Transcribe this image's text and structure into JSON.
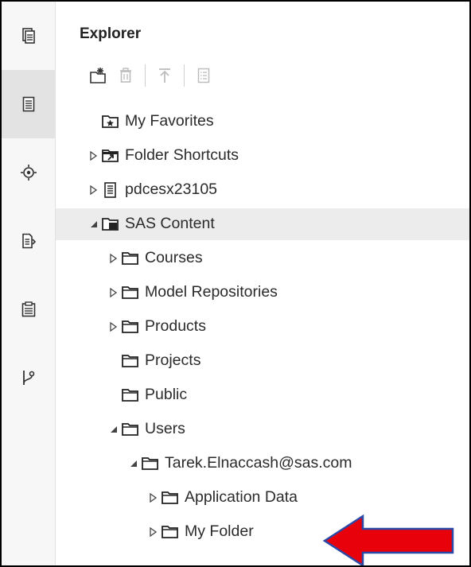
{
  "sidebar": {
    "buttons": [
      {
        "icon": "open-documents-icon"
      },
      {
        "icon": "explorer-icon"
      },
      {
        "icon": "libraries-icon"
      },
      {
        "icon": "snippets-icon"
      },
      {
        "icon": "tasks-icon"
      },
      {
        "icon": "git-repository-icon"
      }
    ],
    "active_index": 1
  },
  "explorer": {
    "title": "Explorer",
    "toolbar": [
      {
        "icon": "new-item-icon",
        "enabled": true
      },
      {
        "icon": "delete-icon",
        "enabled": false
      },
      {
        "icon": "upload-icon",
        "enabled": false
      },
      {
        "icon": "properties-icon",
        "enabled": false
      }
    ]
  },
  "tree": [
    {
      "label": "My Favorites",
      "level": 0,
      "twisty": "none",
      "icon": "favorites-folder-icon"
    },
    {
      "label": "Folder Shortcuts",
      "level": 0,
      "twisty": "collapsed",
      "icon": "folder-shortcut-icon"
    },
    {
      "label": "pdcesx23105",
      "level": 0,
      "twisty": "collapsed",
      "icon": "server-icon"
    },
    {
      "label": "SAS Content",
      "level": 0,
      "twisty": "expanded",
      "icon": "sas-content-icon",
      "selected": true
    },
    {
      "label": "Courses",
      "level": 1,
      "twisty": "collapsed",
      "icon": "folder-icon"
    },
    {
      "label": "Model Repositories",
      "level": 1,
      "twisty": "collapsed",
      "icon": "folder-icon"
    },
    {
      "label": "Products",
      "level": 1,
      "twisty": "collapsed",
      "icon": "folder-icon"
    },
    {
      "label": "Projects",
      "level": 1,
      "twisty": "none",
      "icon": "folder-icon"
    },
    {
      "label": "Public",
      "level": 1,
      "twisty": "none",
      "icon": "folder-icon"
    },
    {
      "label": "Users",
      "level": 1,
      "twisty": "expanded",
      "icon": "folder-icon"
    },
    {
      "label": "Tarek.Elnaccash@sas.com",
      "level": 2,
      "twisty": "expanded",
      "icon": "folder-icon"
    },
    {
      "label": "Application Data",
      "level": 3,
      "twisty": "collapsed",
      "icon": "folder-icon"
    },
    {
      "label": "My Folder",
      "level": 3,
      "twisty": "collapsed",
      "icon": "folder-icon"
    }
  ],
  "annotation": {
    "arrow_color": "#e8000b",
    "arrow_border": "#2b4aa8"
  }
}
